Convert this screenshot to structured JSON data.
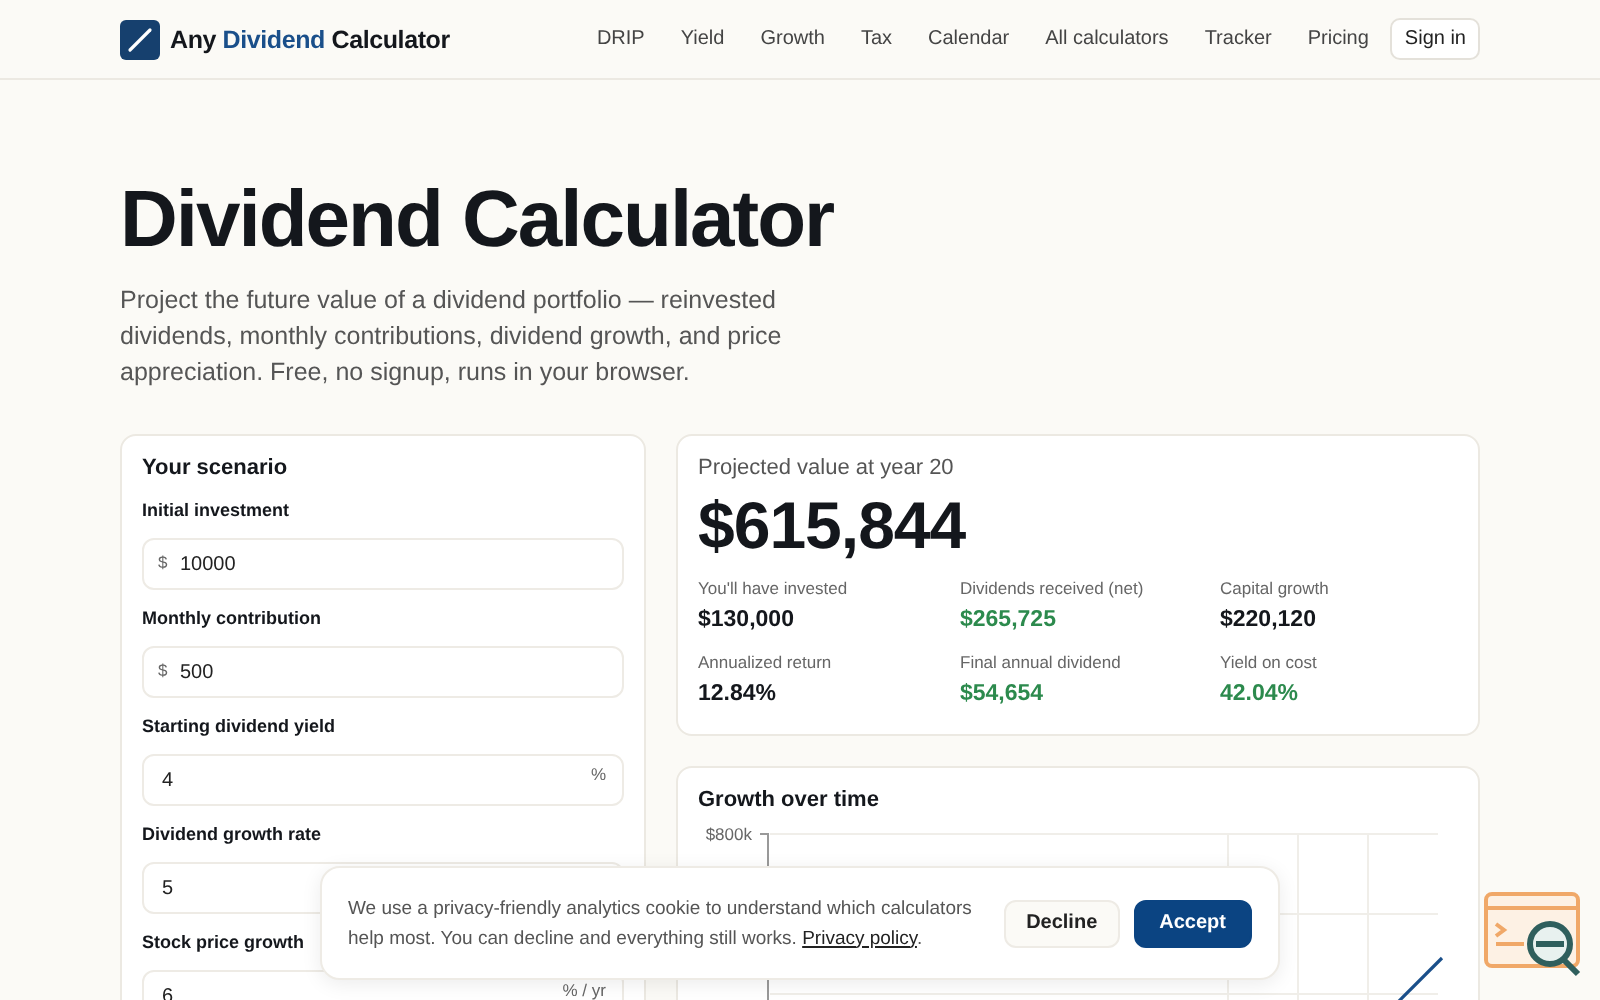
{
  "brand": {
    "prefix": "Any",
    "accent": "Dividend",
    "suffix": "Calculator"
  },
  "nav": {
    "items": [
      "DRIP",
      "Yield",
      "Growth",
      "Tax",
      "Calendar",
      "All calculators",
      "Tracker",
      "Pricing"
    ],
    "sign_in": "Sign in"
  },
  "hero": {
    "title": "Dividend Calculator",
    "subtitle": "Project the future value of a dividend portfolio — reinvested dividends, monthly contributions, dividend growth, and price appreciation. Free, no signup, runs in your browser."
  },
  "scenario": {
    "title": "Your scenario",
    "fields": [
      {
        "label": "Initial investment",
        "value": "10000",
        "prefix": "$"
      },
      {
        "label": "Monthly contribution",
        "value": "500",
        "prefix": "$"
      },
      {
        "label": "Starting dividend yield",
        "value": "4",
        "suffix": "%"
      },
      {
        "label": "Dividend growth rate",
        "value": "5"
      },
      {
        "label": "Stock price growth",
        "value": "6",
        "suffix": "% / yr"
      }
    ]
  },
  "result": {
    "title": "Projected value at year 20",
    "value": "$615,844",
    "stats": [
      {
        "label": "You'll have invested",
        "value": "$130,000",
        "highlight": false
      },
      {
        "label": "Dividends received (net)",
        "value": "$265,725",
        "highlight": true
      },
      {
        "label": "Capital growth",
        "value": "$220,120",
        "highlight": false
      },
      {
        "label": "Annualized return",
        "value": "12.84%",
        "highlight": false
      },
      {
        "label": "Final annual dividend",
        "value": "$54,654",
        "highlight": true
      },
      {
        "label": "Yield on cost",
        "value": "42.04%",
        "highlight": true
      }
    ]
  },
  "growth": {
    "title": "Growth over time",
    "y_tick": "$800k"
  },
  "cookie_banner": {
    "text": "We use a privacy-friendly analytics cookie to understand which calculators help most. You can decline and everything still works.",
    "link": "Privacy policy",
    "after_link": ".",
    "buttons": [
      {
        "label": "Decline",
        "kind": "secondary"
      },
      {
        "label": "Accept",
        "kind": "primary"
      }
    ]
  }
}
